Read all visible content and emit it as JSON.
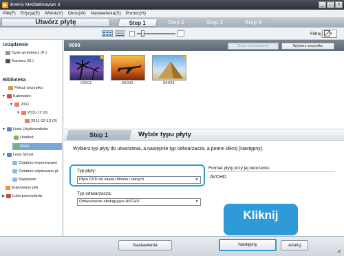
{
  "window": {
    "title": "Everio MediaBrowser 4",
    "controls": [
      "_",
      "□",
      "×"
    ]
  },
  "menu": [
    "Plik(F)",
    "Edycja(E)",
    "Widok(V)",
    "Okno(W)",
    "Nastawienia(S)",
    "Pomoc(H)"
  ],
  "stepbar": {
    "make_label": "Utwórz płytę",
    "steps": [
      "Step 1",
      "Step 2",
      "Step 3",
      "Step 4"
    ],
    "active_step": 1
  },
  "toolbar": {
    "filter_label": "Filtruj"
  },
  "sidebar": {
    "device_header": "Urządzenie",
    "devices": [
      "Dysk wymienny (F:)",
      "Kamera (G:)"
    ],
    "library_header": "Biblioteka",
    "library_items": [
      "Pokaż wszystko",
      "Kalendarz",
      "2011",
      "2011-12 (0)",
      "2011-12-13 (0)",
      "Lista Użytkowników",
      "Untitled",
      "0000",
      "Lista Smart",
      "Ostatnio importowane",
      "Ostatnio edytowane pl.",
      "Najlepsze",
      "Edytowany plik",
      "Lista przesyłania"
    ]
  },
  "main": {
    "folder_title": "0000",
    "unselect_label": "Usuń zaznaczenie",
    "select_all_label": "Wybierz wszystko",
    "thumbnails": [
      {
        "name": "00001"
      },
      {
        "name": "00002"
      },
      {
        "name": "00003"
      }
    ]
  },
  "step_panel": {
    "tab_label": "Step 1",
    "title": "Wybór typu płyty",
    "instructions": "Wybierz typ płyty do utworzenia, a następnie typ odtwarzacza, a potem kliknij [Następny].",
    "disc_type_label": "Typ płyty:",
    "disc_type_value": "Płyta DVD do zapisu filmów i danych",
    "player_type_label": "Typ odtwarzacza:",
    "player_type_value": "Odtwarzacze obsługujące AVCHD",
    "format_label": "Format płyty przy jej tworzeniu:",
    "format_value": "AVCHD"
  },
  "callout": {
    "text": "Kliknij",
    "color": "#2f9ad8"
  },
  "footer": {
    "settings_label": "Nastawienia",
    "next_label": "Następny",
    "cancel_label": "Anuluj"
  }
}
